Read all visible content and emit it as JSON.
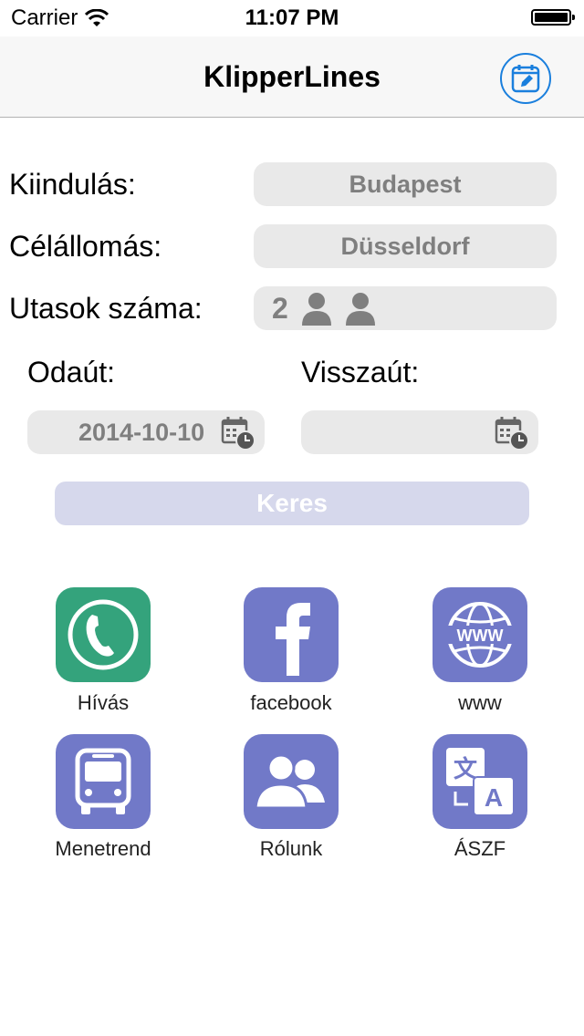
{
  "status": {
    "carrier": "Carrier",
    "time": "11:07 PM"
  },
  "nav": {
    "title": "KlipperLines",
    "right_icon": "calendar-edit-icon",
    "accent": "#1a7fdd"
  },
  "form": {
    "from_label": "Kiindulás:",
    "from_value": "Budapest",
    "to_label": "Célállomás:",
    "to_value": "Düsseldorf",
    "passengers_label": "Utasok száma:",
    "passengers_value": "2",
    "outbound_label": "Odaút:",
    "outbound_date": "2014-10-10",
    "return_label": "Visszaút:",
    "return_date": ""
  },
  "search": {
    "label": "Keres",
    "color": "#d6d8ec"
  },
  "tiles": [
    {
      "label": "Hívás",
      "icon": "phone-icon",
      "color": "#34a37c"
    },
    {
      "label": "facebook",
      "icon": "facebook-icon",
      "color": "#7179c8"
    },
    {
      "label": "www",
      "icon": "globe-icon",
      "color": "#7179c8"
    },
    {
      "label": "Menetrend",
      "icon": "bus-icon",
      "color": "#7179c8"
    },
    {
      "label": "Rólunk",
      "icon": "people-icon",
      "color": "#7179c8"
    },
    {
      "label": "ÁSZF",
      "icon": "translate-icon",
      "color": "#7179c8"
    }
  ]
}
